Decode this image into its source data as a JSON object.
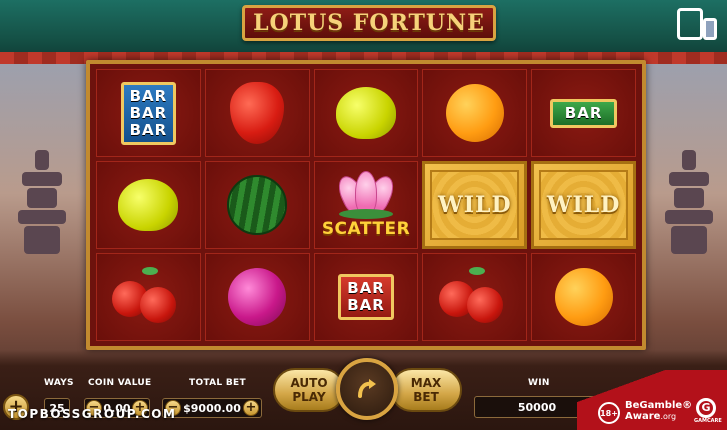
{
  "game": {
    "title": "LOTUS FORTUNE"
  },
  "reels": [
    [
      {
        "symbol": "bar-triple",
        "lines": [
          "BAR",
          "BAR",
          "BAR"
        ]
      },
      {
        "symbol": "lemon"
      },
      {
        "symbol": "cherry"
      }
    ],
    [
      {
        "symbol": "strawberry"
      },
      {
        "symbol": "watermelon"
      },
      {
        "symbol": "plum"
      }
    ],
    [
      {
        "symbol": "lemon"
      },
      {
        "symbol": "scatter",
        "label": "SCATTER"
      },
      {
        "symbol": "bar-double",
        "lines": [
          "BAR",
          "BAR"
        ]
      }
    ],
    [
      {
        "symbol": "orange"
      },
      {
        "symbol": "wild",
        "label": "WILD"
      },
      {
        "symbol": "cherry"
      }
    ],
    [
      {
        "symbol": "bar-single",
        "lines": [
          "BAR"
        ]
      },
      {
        "symbol": "wild",
        "label": "WILD"
      },
      {
        "symbol": "orange"
      }
    ]
  ],
  "controls": {
    "ways_label": "WAYS",
    "ways_value": "25",
    "coin_value_label": "COIN VALUE",
    "coin_value": "0.00",
    "total_bet_label": "TOTAL BET",
    "total_bet_value": "$9000.00",
    "auto_play_line1": "AUTO",
    "auto_play_line2": "PLAY",
    "max_bet_line1": "MAX",
    "max_bet_line2": "BET",
    "win_label": "WIN",
    "win_value": "50000",
    "minus": "−",
    "plus": "+"
  },
  "watermark": "TOPBOSSGROUP.COM",
  "responsible": {
    "age": "18+",
    "begamble_line1": "BeGamble®",
    "begamble_line2": "Aware",
    "begamble_sub": ".org",
    "gamcare": "G",
    "gamcare_label": "GAMCARE"
  },
  "colors": {
    "frame_gold": "#c28a2f",
    "reel_bg": "#6d120d",
    "title_text": "#f6d27a",
    "wild_gold": "#f2c14e",
    "scatter_text": "#ffd23a"
  }
}
